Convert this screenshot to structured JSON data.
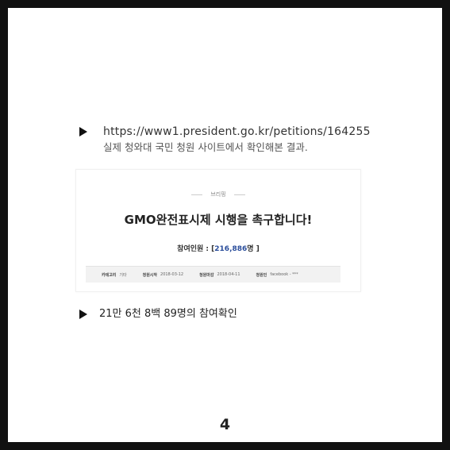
{
  "slide": {
    "url": "https://www1.president.go.kr/petitions/164255",
    "caption": "실제 청와대 국민 청원 사이트에서 확인해본 결과.",
    "petition": {
      "category": "브리핑",
      "title": "GMO완전표시제 시행을 촉구합니다!",
      "count_label": "참여인원 : [",
      "count_value": "216,886",
      "count_suffix": "명 ]",
      "info": [
        {
          "label": "카테고리",
          "value": "기타"
        },
        {
          "label": "청원시작",
          "value": "2018-03-12"
        },
        {
          "label": "청원마감",
          "value": "2018-04-11"
        },
        {
          "label": "청원인",
          "value": "facebook - ***"
        }
      ]
    },
    "check_text": "21만 6천 8백 89명의 참여확인",
    "page_number": "4"
  }
}
